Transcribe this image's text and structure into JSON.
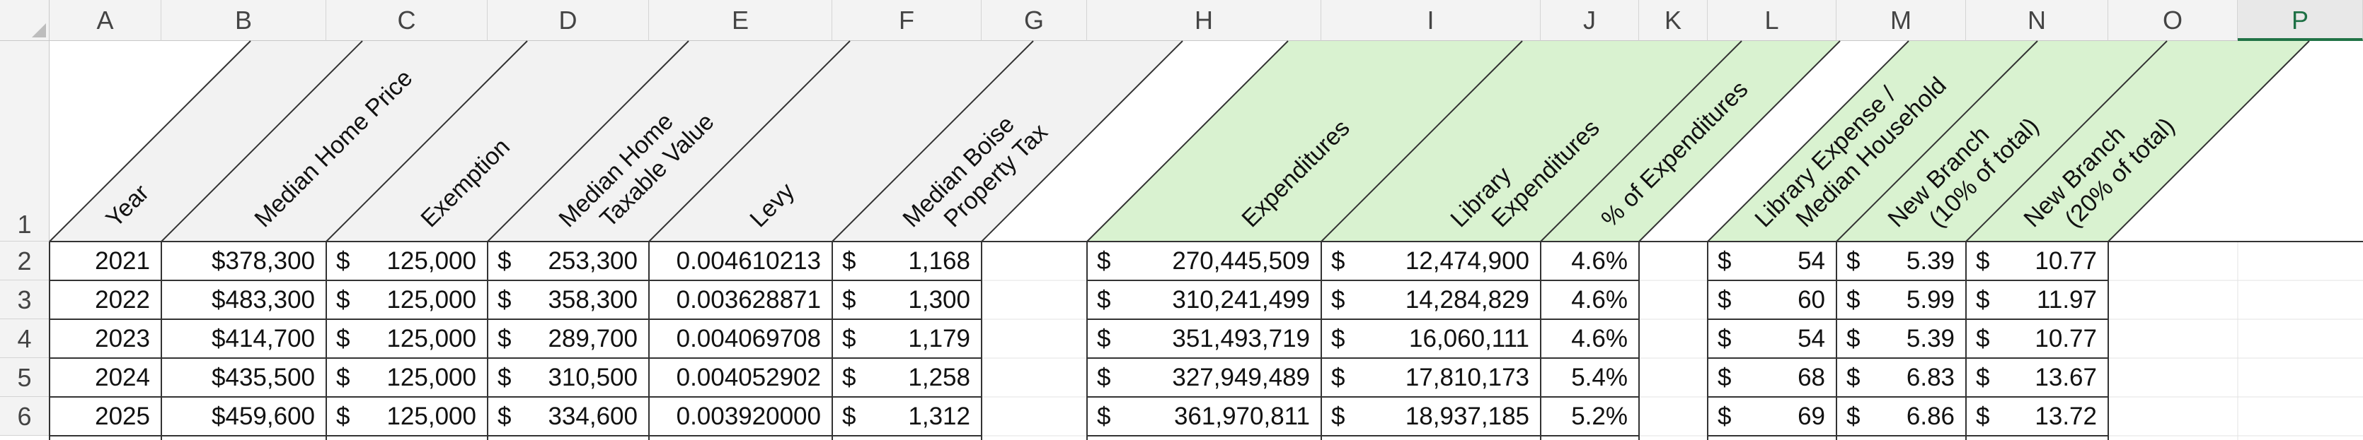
{
  "columns": [
    "A",
    "B",
    "C",
    "D",
    "E",
    "F",
    "G",
    "H",
    "I",
    "J",
    "K",
    "L",
    "M",
    "N",
    "O",
    "P"
  ],
  "selected_column": "P",
  "rows": [
    "1",
    "2",
    "3",
    "4",
    "5",
    "6"
  ],
  "headers": {
    "year": "Year",
    "median_home_price": "Median Home Price",
    "exemption": "Exemption",
    "taxable_value_1": "Median Home",
    "taxable_value_2": "Taxable Value",
    "levy": "Levy",
    "boise_tax_1": "Median Boise",
    "boise_tax_2": "Property Tax",
    "expenditures": "Expenditures",
    "library_exp_1": "Library",
    "library_exp_2": "Expenditures",
    "pct_expenditures": "% of Expenditures",
    "lib_per_household_1": "Library Expense /",
    "lib_per_household_2": "Median Household",
    "new_branch_10_1": "New Branch",
    "new_branch_10_2": "(10% of total)",
    "new_branch_20_1": "New Branch",
    "new_branch_20_2": "(20% of total)"
  },
  "currency_symbol": "$",
  "data": [
    {
      "year": "2021",
      "price": "$378,300",
      "exemption": "125,000",
      "taxable": "253,300",
      "levy": "0.004610213",
      "tax": "1,168",
      "expend": "270,445,509",
      "lib": "12,474,900",
      "pct": "4.6%",
      "per_hh": "54",
      "nb10": "5.39",
      "nb20": "10.77"
    },
    {
      "year": "2022",
      "price": "$483,300",
      "exemption": "125,000",
      "taxable": "358,300",
      "levy": "0.003628871",
      "tax": "1,300",
      "expend": "310,241,499",
      "lib": "14,284,829",
      "pct": "4.6%",
      "per_hh": "60",
      "nb10": "5.99",
      "nb20": "11.97"
    },
    {
      "year": "2023",
      "price": "$414,700",
      "exemption": "125,000",
      "taxable": "289,700",
      "levy": "0.004069708",
      "tax": "1,179",
      "expend": "351,493,719",
      "lib": "16,060,111",
      "pct": "4.6%",
      "per_hh": "54",
      "nb10": "5.39",
      "nb20": "10.77"
    },
    {
      "year": "2024",
      "price": "$435,500",
      "exemption": "125,000",
      "taxable": "310,500",
      "levy": "0.004052902",
      "tax": "1,258",
      "expend": "327,949,489",
      "lib": "17,810,173",
      "pct": "5.4%",
      "per_hh": "68",
      "nb10": "6.83",
      "nb20": "13.67"
    },
    {
      "year": "2025",
      "price": "$459,600",
      "exemption": "125,000",
      "taxable": "334,600",
      "levy": "0.003920000",
      "tax": "1,312",
      "expend": "361,970,811",
      "lib": "18,937,185",
      "pct": "5.2%",
      "per_hh": "69",
      "nb10": "6.86",
      "nb20": "13.72"
    }
  ],
  "colors": {
    "header_green": "#d9f2d0",
    "grid": "#d4d4d4",
    "border": "#333333",
    "selected": "#217346"
  }
}
